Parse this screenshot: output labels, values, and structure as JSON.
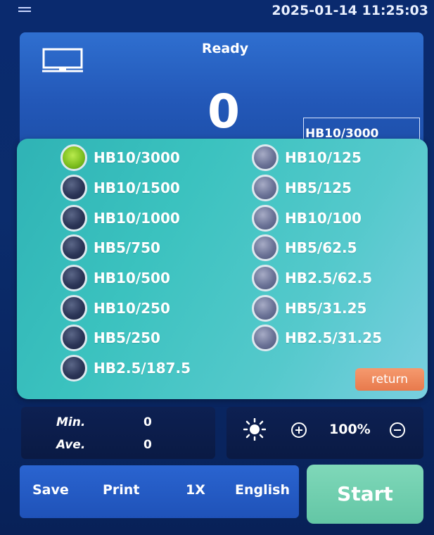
{
  "header": {
    "datetime": "2025-01-14 11:25:03",
    "menu_icon": "hamburger-icon"
  },
  "status_panel": {
    "status": "Ready",
    "reading": "0",
    "current_scale": "HB10/3000",
    "monitor_icon": "monitor-icon"
  },
  "scale_popup": {
    "left_options": [
      {
        "label": "HB10/3000",
        "selected": true
      },
      {
        "label": "HB10/1500",
        "selected": false
      },
      {
        "label": "HB10/1000",
        "selected": false
      },
      {
        "label": "HB5/750",
        "selected": false
      },
      {
        "label": "HB10/500",
        "selected": false
      },
      {
        "label": "HB10/250",
        "selected": false
      },
      {
        "label": "HB5/250",
        "selected": false
      },
      {
        "label": "HB2.5/187.5",
        "selected": false
      }
    ],
    "right_options": [
      {
        "label": "HB10/125",
        "selected": false
      },
      {
        "label": "HB5/125",
        "selected": false
      },
      {
        "label": "HB10/100",
        "selected": false
      },
      {
        "label": "HB5/62.5",
        "selected": false
      },
      {
        "label": "HB2.5/62.5",
        "selected": false
      },
      {
        "label": "HB5/31.25",
        "selected": false
      },
      {
        "label": "HB2.5/31.25",
        "selected": false
      }
    ],
    "return_label": "return",
    "return_color": "#e87a4c",
    "selected_color": "#7fc021"
  },
  "stats": {
    "min_label": "Min.",
    "min_value": "0",
    "ave_label": "Ave.",
    "ave_value": "0"
  },
  "light": {
    "sun_icon": "brightness-icon",
    "plus_icon": "plus-circle-icon",
    "brightness": "100%",
    "minus_icon": "minus-circle-icon"
  },
  "bottom_bar": {
    "save": "Save",
    "print": "Print",
    "zoom": "1X",
    "language": "English"
  },
  "start": {
    "label": "Start",
    "color": "#63c6a5"
  }
}
